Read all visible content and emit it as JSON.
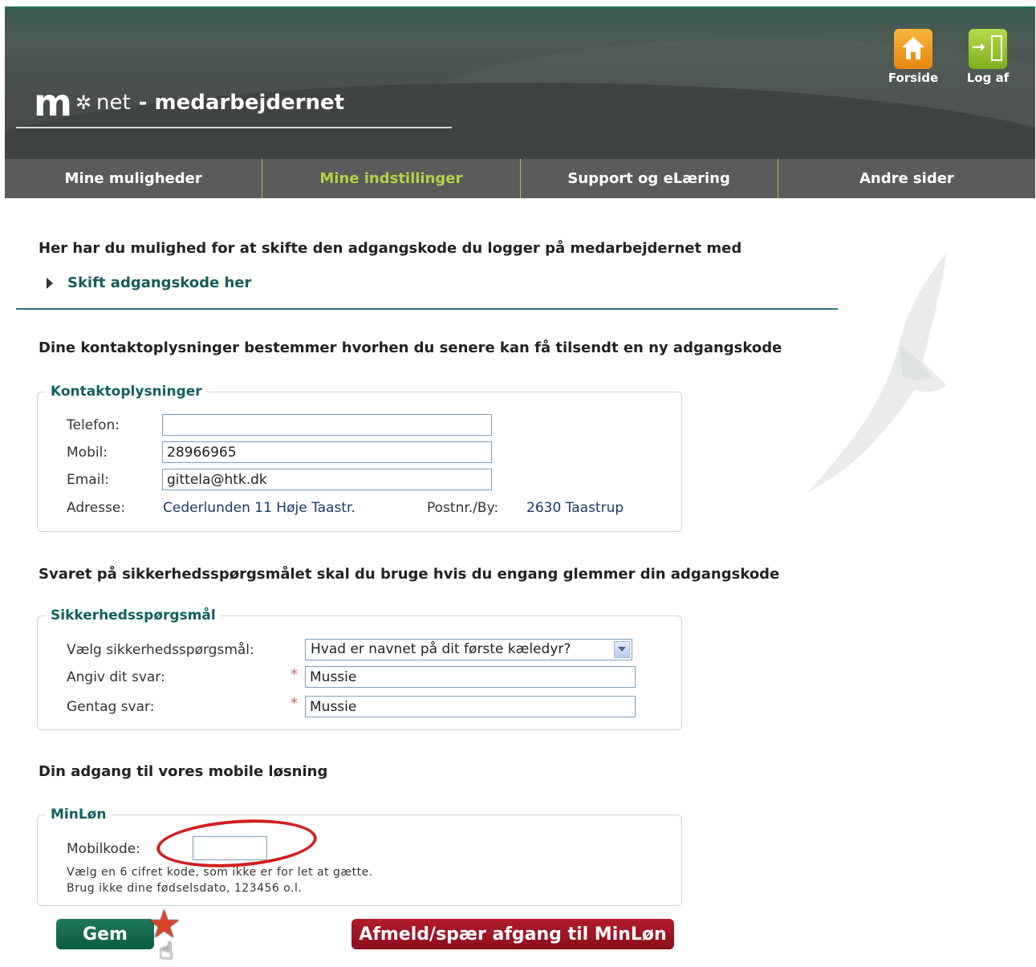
{
  "header": {
    "logo_m": "m",
    "logo_net": "net",
    "logo_rest": "- medarbejdernet",
    "forside": "Forside",
    "logaf": "Log af"
  },
  "nav": {
    "tabs": [
      {
        "label": "Mine muligheder"
      },
      {
        "label": "Mine indstillinger"
      },
      {
        "label": "Support og eLæring"
      },
      {
        "label": "Andre sider"
      }
    ]
  },
  "password": {
    "intro": "Her har du mulighed for at skifte den adgangskode du logger på medarbejdernet med",
    "link": "Skift adgangskode her"
  },
  "contact": {
    "intro": "Dine kontaktoplysninger bestemmer hvorhen du senere kan få tilsendt en ny adgangskode",
    "legend": "Kontaktoplysninger",
    "telefon_label": "Telefon:",
    "telefon_value": "",
    "mobil_label": "Mobil:",
    "mobil_value": "28966965",
    "email_label": "Email:",
    "email_value": "gittela@htk.dk",
    "adresse_label": "Adresse:",
    "adresse_value": "Cederlunden 11 Høje Taastr.",
    "postnr_label": "Postnr./By:",
    "postnr_value": "2630 Taastrup"
  },
  "security": {
    "intro": "Svaret på sikkerhedsspørgsmålet skal du bruge hvis du engang glemmer din adgangskode",
    "legend": "Sikkerhedsspørgsmål",
    "question_label": "Vælg sikkerhedsspørgsmål:",
    "question_value": "Hvad er navnet på dit første kæledyr?",
    "answer_label": "Angiv dit svar:",
    "answer_value": "Mussie",
    "repeat_label": "Gentag svar:",
    "repeat_value": "Mussie",
    "required_mark": "*"
  },
  "mobile": {
    "intro": "Din adgang til vores mobile løsning",
    "legend": "MinLøn",
    "code_label": "Mobilkode:",
    "code_value": "",
    "hint1": "Vælg en 6 cifret kode, som ikke er for let at gætte.",
    "hint2": "Brug ikke dine fødselsdato, 123456 o.l."
  },
  "buttons": {
    "save": "Gem",
    "unsubscribe": "Afmeld/spær afgang til MinLøn"
  }
}
